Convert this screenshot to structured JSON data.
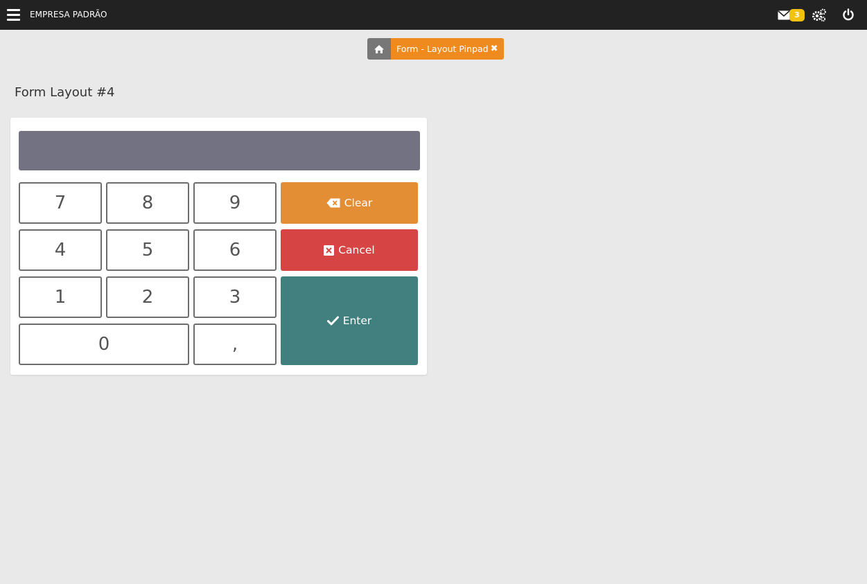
{
  "header": {
    "company": "EMPRESA PADRÃO",
    "mail_count": "3"
  },
  "breadcrumb": {
    "tab_label": "Form - Layout Pinpad",
    "close": "✖"
  },
  "page": {
    "title": "Form Layout #4"
  },
  "pinpad": {
    "display_value": "",
    "keys": {
      "k7": "7",
      "k8": "8",
      "k9": "9",
      "k4": "4",
      "k5": "5",
      "k6": "6",
      "k1": "1",
      "k2": "2",
      "k3": "3",
      "k0": "0",
      "comma": ","
    },
    "clear_label": "Clear",
    "cancel_label": "Cancel",
    "enter_label": "Enter"
  },
  "colors": {
    "topbar": "#222222",
    "badge": "#f3c20f",
    "breadcrumb_tab": "#ef8a1e",
    "display": "#737283",
    "clear": "#e38d35",
    "cancel": "#d74444",
    "enter": "#427f7f"
  },
  "icons": [
    "menu-icon",
    "envelope-icon",
    "gears-icon",
    "power-icon",
    "home-icon",
    "close-icon",
    "backspace-icon",
    "cancel-square-icon",
    "check-icon"
  ]
}
